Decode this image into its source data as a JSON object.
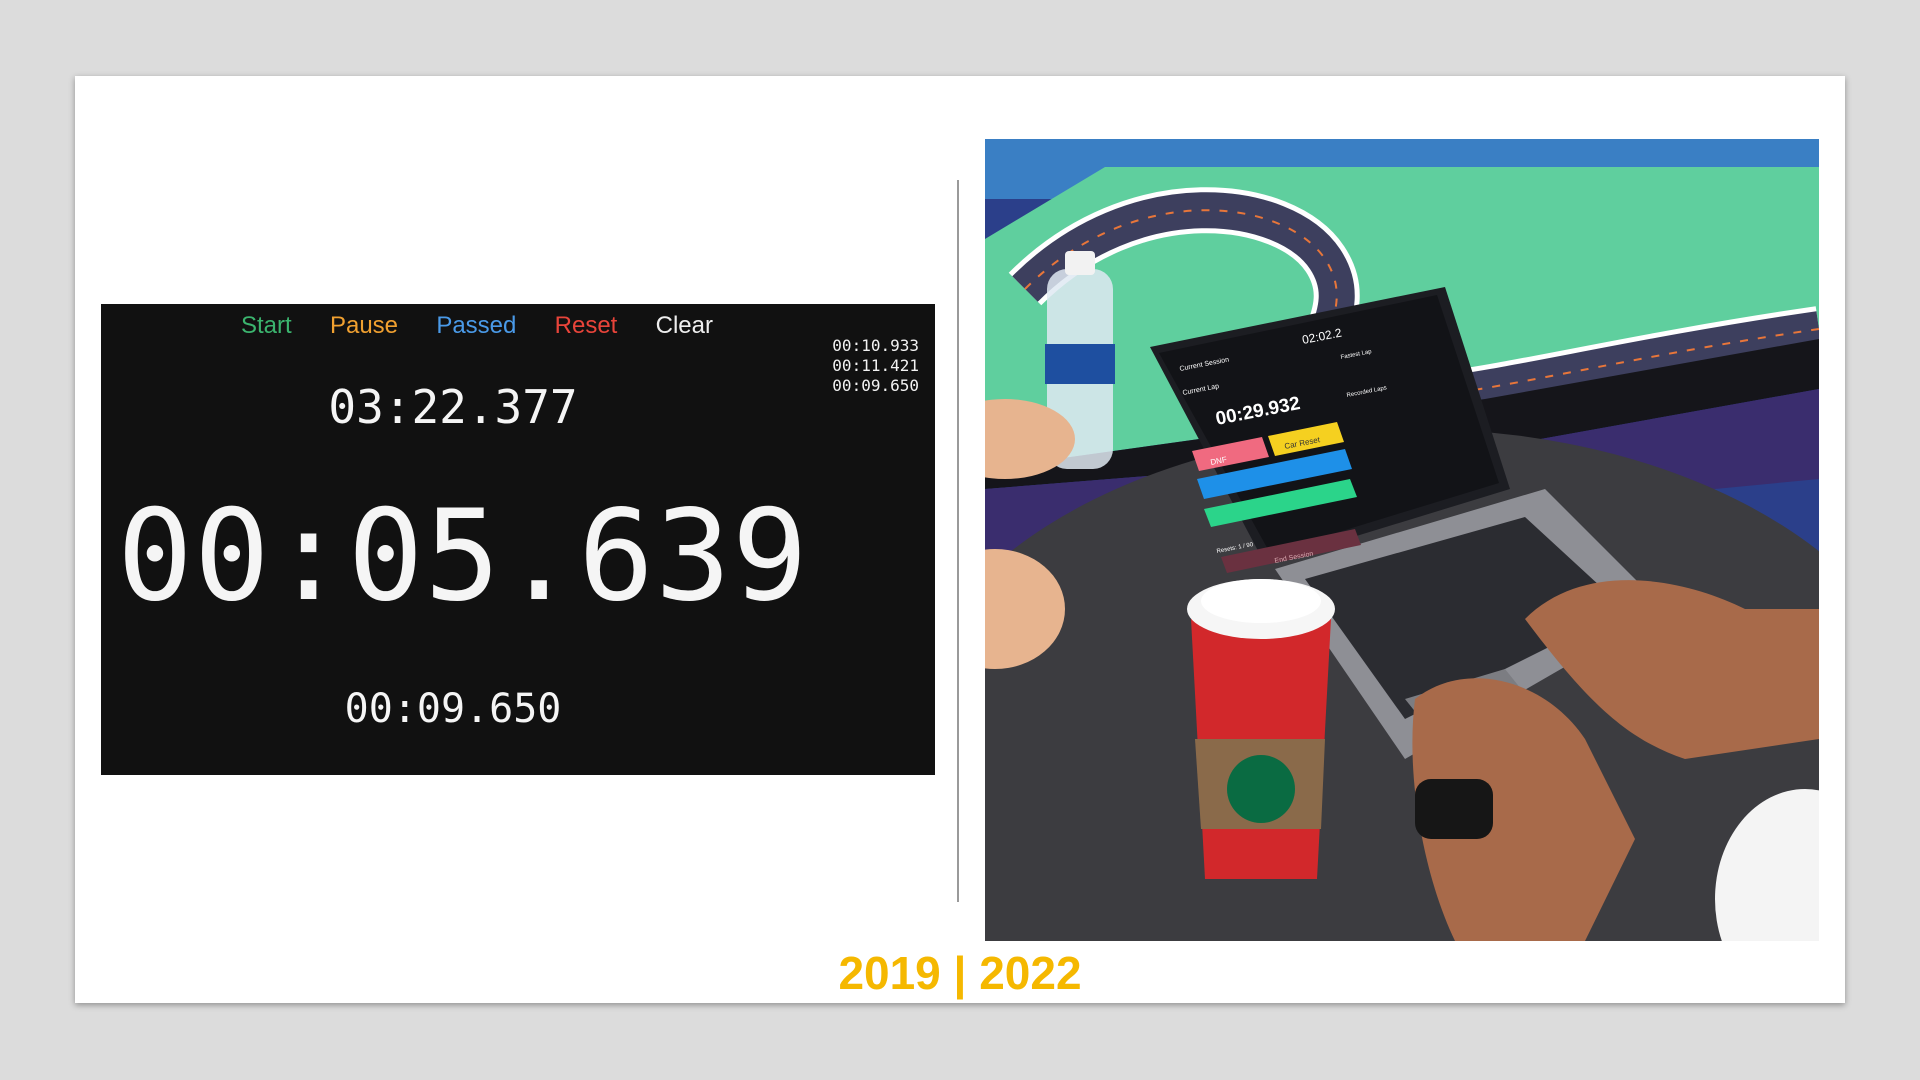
{
  "stopwatch": {
    "controls": [
      "Start",
      "Pause",
      "Passed",
      "Reset",
      "Clear"
    ],
    "recent_laps": [
      "00:10.933",
      "00:11.421",
      "00:09.650"
    ],
    "total_time": "03:22.377",
    "current_time": "00:05.639",
    "last_lap": "00:09.650"
  },
  "laptop_screen": {
    "session_timer": "02:02.2",
    "section_current_session": "Current Session",
    "section_current_lap": "Current Lap",
    "lap_time": "00:29.932",
    "button_dnf": "DNF",
    "button_car_reset": "Car Reset",
    "button_end_session": "End Session",
    "fastest_lap_label": "Fastest Lap",
    "recorded_laps_label": "Recorded Laps",
    "resets_label": "Resets: 1 / 90"
  },
  "footer": {
    "years": "2019 | 2022"
  },
  "colors": {
    "start": "#3bb46e",
    "pause": "#f0a030",
    "passed": "#4a9ae8",
    "reset": "#e8443a",
    "clear": "#eeeeee",
    "year_accent": "#f5b800"
  }
}
